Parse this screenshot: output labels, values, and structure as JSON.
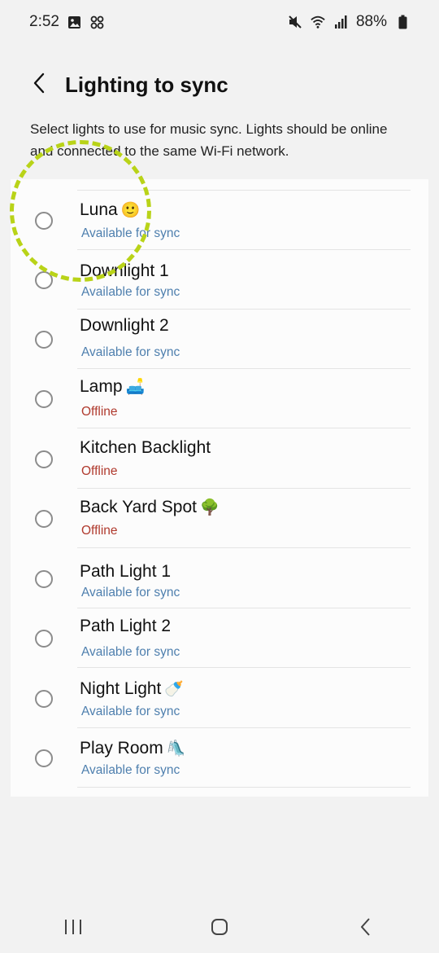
{
  "status_bar": {
    "time": "2:52",
    "battery": "88%",
    "left_icons": [
      "image-icon",
      "fan-icon"
    ],
    "right_icons": [
      "mute-icon",
      "wifi-icon",
      "signal-icon",
      "battery-icon"
    ]
  },
  "header": {
    "title": "Lighting to sync",
    "back_icon": "chevron-left-icon"
  },
  "description": "Select lights to use for music sync. Lights should be online and connected to the same Wi-Fi network.",
  "lights": [
    {
      "name": "Luna",
      "emoji": "🙂",
      "status": "Available for sync",
      "state": "available",
      "selected": false
    },
    {
      "name": "Downlight 1",
      "emoji": "",
      "status": "Available for sync",
      "state": "available",
      "selected": false
    },
    {
      "name": "Downlight 2",
      "emoji": "",
      "status": "Available for sync",
      "state": "available",
      "selected": false
    },
    {
      "name": "Lamp",
      "emoji": "🛋️",
      "status": "Offline",
      "state": "offline",
      "selected": false
    },
    {
      "name": "Kitchen Backlight",
      "emoji": "",
      "status": "Offline",
      "state": "offline",
      "selected": false
    },
    {
      "name": "Back Yard Spot",
      "emoji": "🌳",
      "status": "Offline",
      "state": "offline",
      "selected": false
    },
    {
      "name": "Path Light 1",
      "emoji": "",
      "status": "Available for sync",
      "state": "available",
      "selected": false
    },
    {
      "name": "Path Light 2",
      "emoji": "",
      "status": "Available for sync",
      "state": "available",
      "selected": false
    },
    {
      "name": "Night Light",
      "emoji": "🍼",
      "status": "Available for sync",
      "state": "available",
      "selected": false
    },
    {
      "name": "Play Room",
      "emoji": "🛝",
      "status": "Available for sync",
      "state": "available",
      "selected": false
    }
  ],
  "colors": {
    "available": "#4e7fae",
    "offline": "#b03a2e",
    "highlight": "#b9d318"
  },
  "nav_bar": {
    "icons": [
      "recent-apps-icon",
      "home-icon",
      "back-icon"
    ]
  }
}
